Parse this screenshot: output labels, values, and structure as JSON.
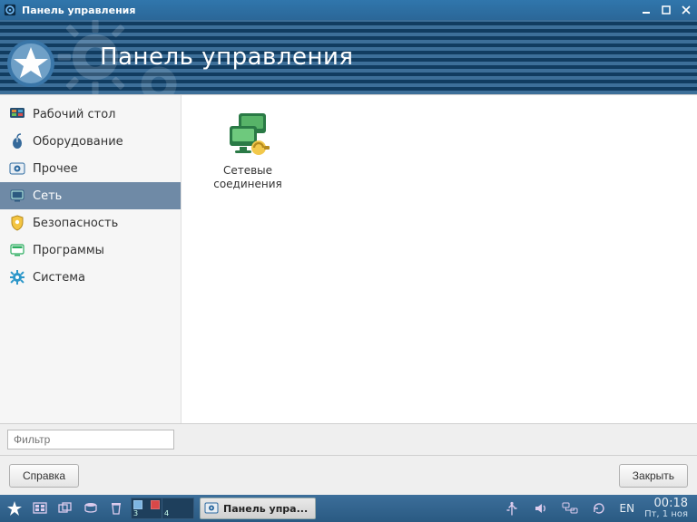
{
  "window": {
    "title": "Панель управления",
    "header_title": "Панель управления"
  },
  "sidebar": {
    "items": [
      {
        "id": "desktop",
        "label": "Рабочий стол",
        "icon": "desktop"
      },
      {
        "id": "hardware",
        "label": "Оборудование",
        "icon": "mouse"
      },
      {
        "id": "other",
        "label": "Прочее",
        "icon": "gear"
      },
      {
        "id": "network",
        "label": "Сеть",
        "icon": "screen",
        "selected": true
      },
      {
        "id": "security",
        "label": "Безопасность",
        "icon": "shield"
      },
      {
        "id": "programs",
        "label": "Программы",
        "icon": "app"
      },
      {
        "id": "system",
        "label": "Система",
        "icon": "cog"
      }
    ]
  },
  "content": {
    "items": [
      {
        "id": "netconn",
        "label": "Сетевые соединения"
      }
    ]
  },
  "filter": {
    "placeholder": "Фильтр"
  },
  "buttons": {
    "help": "Справка",
    "close": "Закрыть"
  },
  "taskbar": {
    "task_label": "Панель упра...",
    "lang": "EN",
    "time": "00:18",
    "date": "Пт, 1 ноя",
    "pager": {
      "pages": [
        3,
        4
      ]
    }
  }
}
